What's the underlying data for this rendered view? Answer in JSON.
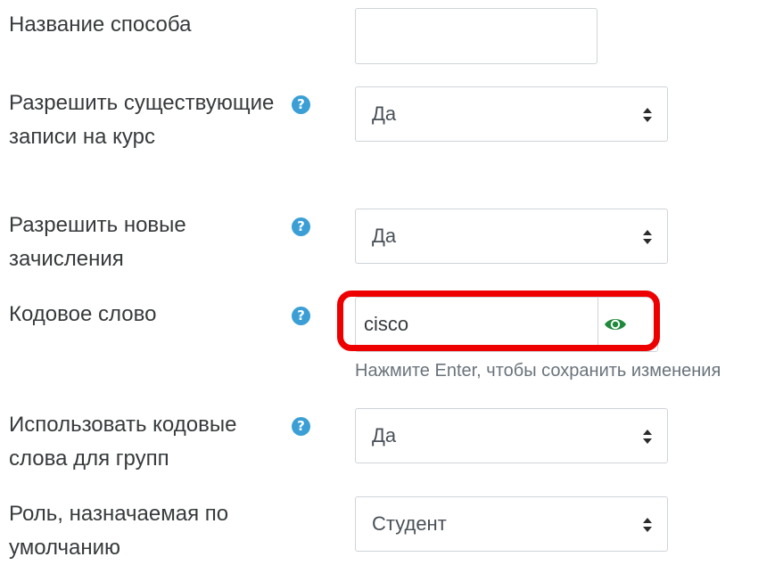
{
  "fields": {
    "method_name": {
      "label": "Название способа",
      "value": ""
    },
    "allow_existing": {
      "label": "Разрешить существующие записи на курс",
      "value": "Да"
    },
    "allow_new": {
      "label": "Разрешить новые зачисления",
      "value": "Да"
    },
    "password": {
      "label": "Кодовое слово",
      "value": "cisco",
      "hint": "Нажмите Enter, чтобы сохранить изменения"
    },
    "group_keys": {
      "label": "Использовать кодовые слова для групп",
      "value": "Да"
    },
    "default_role": {
      "label": "Роль, назначаемая по умолчанию",
      "value": "Студент"
    }
  },
  "icons": {
    "help": "question-circle-icon",
    "eye": "eye-icon",
    "select_arrows": "sort-arrows-icon"
  },
  "colors": {
    "help_icon": "#3b9fd6",
    "eye_icon": "#1f8a3c",
    "highlight": "#ee0000"
  }
}
